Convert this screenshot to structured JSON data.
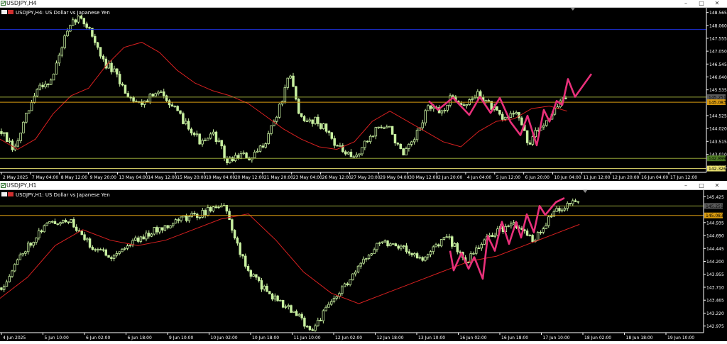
{
  "windows": [
    {
      "window_title": "USDJPY,H4",
      "chart_label": "USDJPY,H4: US Dollar vs Japanese Yen",
      "buttons": {
        "minimize": "–",
        "maximize": "□",
        "close": "✕"
      },
      "yticks": [
        "148.565",
        "148.060",
        "147.555",
        "147.050",
        "146.545",
        "146.040",
        "145.535",
        "144.525",
        "144.020",
        "143.515",
        "143.010",
        "142.505"
      ],
      "hlines": [
        {
          "price": 147.9,
          "color": "#1c2fd6"
        },
        {
          "price": 145.25,
          "color": "#9aa83b"
        },
        {
          "price": 145.05,
          "color": "#d89a10"
        },
        {
          "price": 142.85,
          "color": "#8fa035"
        },
        {
          "price": 142.45,
          "color": "#e8e070"
        }
      ],
      "price_tags": [
        {
          "text": "145.251",
          "bg": "#5a5a5a",
          "price": 145.25
        },
        {
          "text": "145.083",
          "bg": "#d89a10",
          "price": 145.05
        },
        {
          "text": "142.899",
          "bg": "#4e7c24",
          "price": 142.85
        },
        {
          "text": "142.326",
          "bg": "#e8e070",
          "price": 142.45
        }
      ],
      "xticks": [
        "2 May 2025",
        "7 May 04:00",
        "8 May 12:00",
        "9 May 20:00",
        "13 May 04:00",
        "14 May 12:00",
        "15 May 20:00",
        "19 May 04:00",
        "20 May 12:00",
        "21 May 20:00",
        "23 May 04:00",
        "26 May 12:00",
        "27 May 20:00",
        "29 May 04:00",
        "30 May 12:00",
        "2 Jun 20:00",
        "4 Jun 04:00",
        "5 Jun 12:00",
        "6 Jun 20:00",
        "10 Jun 04:00",
        "11 Jun 12:00",
        "12 Jun 20:00",
        "16 Jun 04:00",
        "17 Jun 12:00"
      ],
      "annotation_color": "#e8307a",
      "last_close": 145.25
    },
    {
      "window_title": "USDJPY,H1",
      "chart_label": "USDJPY,H1: US Dollar vs Japanese Yen",
      "buttons": {
        "minimize": "–",
        "maximize": "□",
        "close": "✕"
      },
      "yticks": [
        "145.425",
        "144.935",
        "144.690",
        "144.445",
        "144.200",
        "143.955",
        "143.710",
        "143.465",
        "143.220",
        "142.975"
      ],
      "hlines": [
        {
          "price": 145.25,
          "color": "#9aa83b"
        },
        {
          "price": 145.07,
          "color": "#d89a10"
        }
      ],
      "price_tags": [
        {
          "text": "145.251",
          "bg": "#5a5a5a",
          "price": 145.25
        },
        {
          "text": "145.083",
          "bg": "#d89a10",
          "price": 145.07
        }
      ],
      "xticks": [
        "4 Jun 2025",
        "5 Jun 10:00",
        "6 Jun 02:00",
        "6 Jun 18:00",
        "9 Jun 10:00",
        "10 Jun 02:00",
        "10 Jun 18:00",
        "11 Jun 10:00",
        "12 Jun 02:00",
        "12 Jun 18:00",
        "13 Jun 10:00",
        "16 Jun 02:00",
        "16 Jun 18:00",
        "17 Jun 10:00",
        "18 Jun 02:00",
        "18 Jun 18:00",
        "19 Jun 10:00"
      ],
      "annotation_color": "#e8307a",
      "last_close": 145.32
    }
  ],
  "chart_data": [
    {
      "type": "candlestick",
      "symbol": "USDJPY",
      "timeframe": "H4",
      "ylim": [
        142.3,
        148.75
      ],
      "candle_count": 250,
      "series": [
        {
          "name": "MA",
          "color": "#d82020",
          "values": [
            143.6,
            143.2,
            143.6,
            144.6,
            145.3,
            145.6,
            146.5,
            147.2,
            147.4,
            147.0,
            146.3,
            145.8,
            145.5,
            145.3,
            145.0,
            144.5,
            144.0,
            143.6,
            143.3,
            143.2,
            143.5,
            144.3,
            144.7,
            144.3,
            143.9,
            143.5,
            143.3,
            143.9,
            144.3,
            144.4,
            144.8,
            144.9,
            144.7
          ]
        }
      ],
      "price_path": [
        143.9,
        143.1,
        144.5,
        145.7,
        145.9,
        147.5,
        148.4,
        148.0,
        146.7,
        146.2,
        145.4,
        145.0,
        145.3,
        145.4,
        144.6,
        144.1,
        143.4,
        143.8,
        142.7,
        143.0,
        142.8,
        143.5,
        144.6,
        146.1,
        144.2,
        144.4,
        143.9,
        143.2,
        142.8,
        143.4,
        144.1,
        144.0,
        142.9,
        143.6,
        144.9,
        144.6,
        145.3,
        144.9,
        145.4,
        144.9,
        144.3,
        144.8,
        143.4,
        144.1,
        144.7,
        145.3
      ],
      "projection": [
        145.09,
        144.75,
        145.23,
        144.55,
        145.26,
        144.63,
        145.22,
        144.28,
        143.76,
        144.52,
        143.36,
        144.75,
        144.29,
        145.1,
        144.94,
        145.96,
        145.26,
        146.16
      ]
    },
    {
      "type": "candlestick",
      "symbol": "USDJPY",
      "timeframe": "H1",
      "ylim": [
        142.85,
        145.55
      ],
      "candle_count": 260,
      "series": [
        {
          "name": "MA",
          "color": "#d82020",
          "values": [
            143.5,
            143.9,
            144.5,
            144.8,
            144.6,
            144.5,
            144.6,
            144.8,
            145.0,
            145.1,
            144.6,
            144.0,
            143.6,
            143.4,
            143.6,
            143.8,
            144.0,
            144.2,
            144.3,
            144.5,
            144.7,
            144.9
          ]
        }
      ],
      "price_path": [
        143.7,
        144.4,
        144.9,
        145.0,
        144.5,
        144.3,
        144.6,
        144.8,
        145.0,
        145.1,
        145.3,
        144.1,
        143.6,
        143.3,
        142.9,
        143.5,
        144.0,
        144.6,
        144.5,
        144.2,
        144.7,
        144.2,
        144.7,
        144.9,
        144.6,
        145.2,
        145.32
      ],
      "projection": [
        144.4,
        144.03,
        144.36,
        144.06,
        144.28,
        143.87,
        144.68,
        144.4,
        144.95,
        144.53,
        144.95,
        144.65,
        145.09,
        144.75,
        145.25,
        145.08,
        145.32,
        145.4
      ]
    }
  ]
}
